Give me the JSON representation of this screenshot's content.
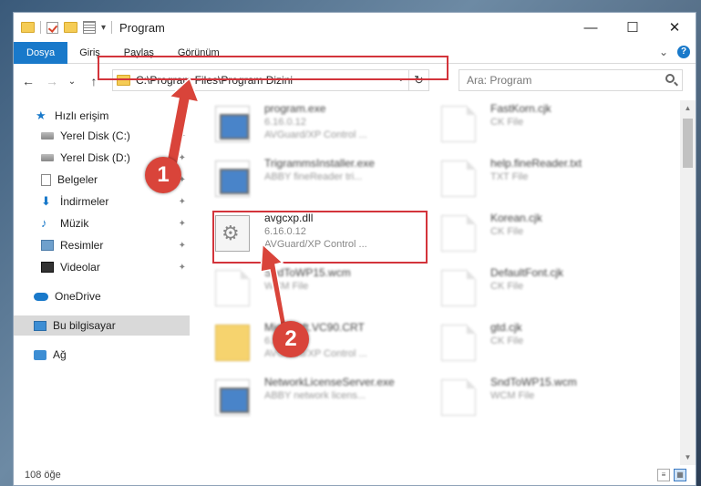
{
  "window": {
    "title": "Program",
    "minimize_glyph": "—",
    "maximize_glyph": "☐",
    "close_glyph": "✕"
  },
  "quick_access_toolbar": {
    "icons": [
      "folder-icon",
      "properties-icon",
      "new-folder-icon",
      "customize-icon"
    ],
    "dropdown_glyph": "▾"
  },
  "ribbon": {
    "tabs": [
      {
        "label": "Dosya",
        "active": true
      },
      {
        "label": "Giriş",
        "active": false
      },
      {
        "label": "Paylaş",
        "active": false
      },
      {
        "label": "Görünüm",
        "active": false
      }
    ],
    "collapse_glyph": "⌄",
    "help_glyph": "?"
  },
  "navigation": {
    "back_glyph": "←",
    "forward_glyph": "→",
    "recent_glyph": "⌄",
    "up_glyph": "↑"
  },
  "address_bar": {
    "path": "C:\\Program Files\\Program Dizini",
    "dropdown_glyph": "⌄",
    "refresh_glyph": "↻"
  },
  "search": {
    "placeholder": "Ara: Program"
  },
  "nav_pane": {
    "items": [
      {
        "label": "Hızlı erişim",
        "icon": "star-icon",
        "pinned": false
      },
      {
        "label": "Yerel Disk (C:)",
        "icon": "drive-icon",
        "pinned": true
      },
      {
        "label": "Yerel Disk (D:)",
        "icon": "drive-icon",
        "pinned": true
      },
      {
        "label": "Belgeler",
        "icon": "documents-icon",
        "pinned": true
      },
      {
        "label": "İndirmeler",
        "icon": "downloads-icon",
        "pinned": true
      },
      {
        "label": "Müzik",
        "icon": "music-icon",
        "pinned": true
      },
      {
        "label": "Resimler",
        "icon": "pictures-icon",
        "pinned": true
      },
      {
        "label": "Videolar",
        "icon": "videos-icon",
        "pinned": true
      },
      {
        "label": "OneDrive",
        "icon": "onedrive-icon",
        "pinned": false
      },
      {
        "label": "Bu bilgisayar",
        "icon": "this-pc-icon",
        "pinned": false,
        "selected": true
      },
      {
        "label": "Ağ",
        "icon": "network-icon",
        "pinned": false
      }
    ],
    "pin_glyph": "📌"
  },
  "files": [
    {
      "name": "program.exe",
      "line2": "6.16.0.12",
      "line3": "AVGuard/XP Control ...",
      "icon": "exe-icon"
    },
    {
      "name": "FastKorn.cjk",
      "line2": "CK File",
      "line3": "",
      "icon": "file-icon"
    },
    {
      "name": "TrigrammsInstaller.exe",
      "line2": "ABBY fineReader tri...",
      "line3": "",
      "icon": "app-icon"
    },
    {
      "name": "help.fineReader.txt",
      "line2": "TXT File",
      "line3": "",
      "icon": "file-icon"
    },
    {
      "name": "avgcxp.dll",
      "line2": "6.16.0.12",
      "line3": "AVGuard/XP Control ...",
      "icon": "dll-gear-icon"
    },
    {
      "name": "Korean.cjk",
      "line2": "CK File",
      "line3": "",
      "icon": "file-icon"
    },
    {
      "name": "SndToWP15.wcm",
      "line2": "WCM File",
      "line3": "",
      "icon": "file-icon"
    },
    {
      "name": "DefaultFont.cjk",
      "line2": "CK File",
      "line3": "",
      "icon": "file-icon"
    },
    {
      "name": "Microsoft.VC90.CRT",
      "line2": "6.16.0.12",
      "line3": "AVGuard/XP Control ...",
      "icon": "folder-zip-icon"
    },
    {
      "name": "gtd.cjk",
      "line2": "CK File",
      "line3": "",
      "icon": "file-icon"
    },
    {
      "name": "NetworkLicenseServer.exe",
      "line2": "ABBY network licens...",
      "line3": "",
      "icon": "app-icon"
    },
    {
      "name": "SndToWP15.wcm",
      "line2": "WCM File",
      "line3": "",
      "icon": "file-icon"
    }
  ],
  "status_bar": {
    "item_count": "108 öğe"
  },
  "annotations": [
    {
      "number": "1",
      "color": "#d9443a"
    },
    {
      "number": "2",
      "color": "#d9443a"
    }
  ]
}
